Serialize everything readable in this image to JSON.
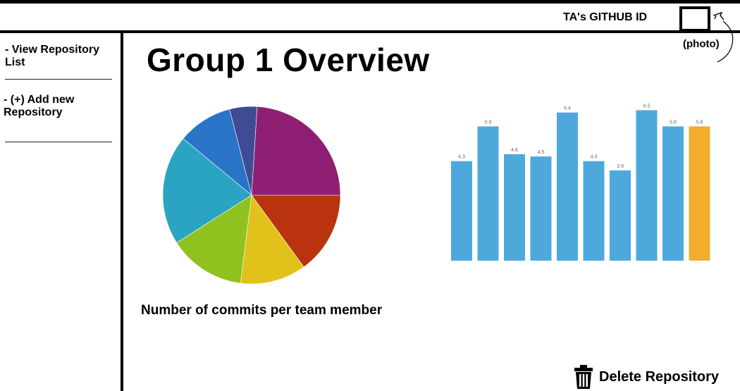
{
  "header": {
    "ta_github_id_label": "TA's GITHUB ID",
    "photo_label": "(photo)"
  },
  "sidebar": {
    "items": [
      {
        "label": "- View Repository List"
      },
      {
        "label": "- (+) Add new Repository"
      }
    ]
  },
  "main": {
    "title": "Group 1 Overview",
    "pie_caption": "Number of commits per team member",
    "delete_label": "Delete Repository"
  },
  "colors": {
    "bar_default": "#4fa8dc",
    "bar_highlight": "#f2ad2e"
  },
  "chart_data": [
    {
      "type": "pie",
      "values": [
        15,
        12,
        14,
        20,
        10,
        5,
        24
      ],
      "colors": [
        "#b8330e",
        "#e0c21a",
        "#8fc21f",
        "#2aa4c2",
        "#2a74c8",
        "#3f4b94",
        "#8e1f72"
      ]
    },
    {
      "type": "bar",
      "values": [
        4.3,
        5.8,
        4.6,
        4.5,
        6.4,
        4.3,
        3.9,
        6.5,
        5.8,
        5.8
      ],
      "highlight_index": 9,
      "ylim": [
        0,
        7
      ]
    }
  ]
}
